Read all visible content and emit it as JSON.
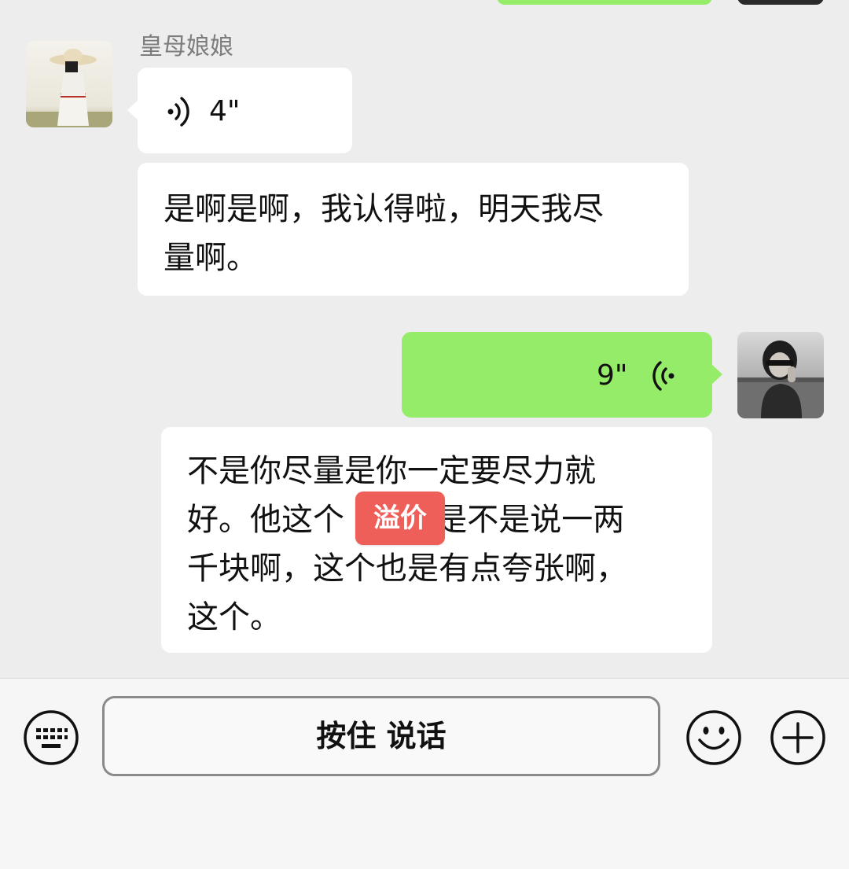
{
  "chat": {
    "sender_name": "皇母娘娘",
    "messages": [
      {
        "type": "voice",
        "side": "left",
        "duration": "4\""
      },
      {
        "type": "text",
        "side": "left",
        "lines": [
          "是啊是啊，我认得啦，明天我尽",
          "量啊。"
        ]
      },
      {
        "type": "voice",
        "side": "right",
        "duration": "9\""
      },
      {
        "type": "text",
        "side": "left",
        "lines": [
          "不是你尽量是你一定要尽力就",
          "好。他这个      不是不是说一两",
          "千块啊，这个也是有点夸张啊，",
          "这个。"
        ],
        "badge": "溢价"
      }
    ]
  },
  "input_bar": {
    "hold_to_talk_label": "按住 说话",
    "icons": [
      "keyboard-icon",
      "emoji-icon",
      "plus-icon"
    ]
  },
  "colors": {
    "background": "#ededed",
    "bubble_self": "#95ec69",
    "bubble_other": "#ffffff",
    "badge": "#ef5f5a"
  }
}
